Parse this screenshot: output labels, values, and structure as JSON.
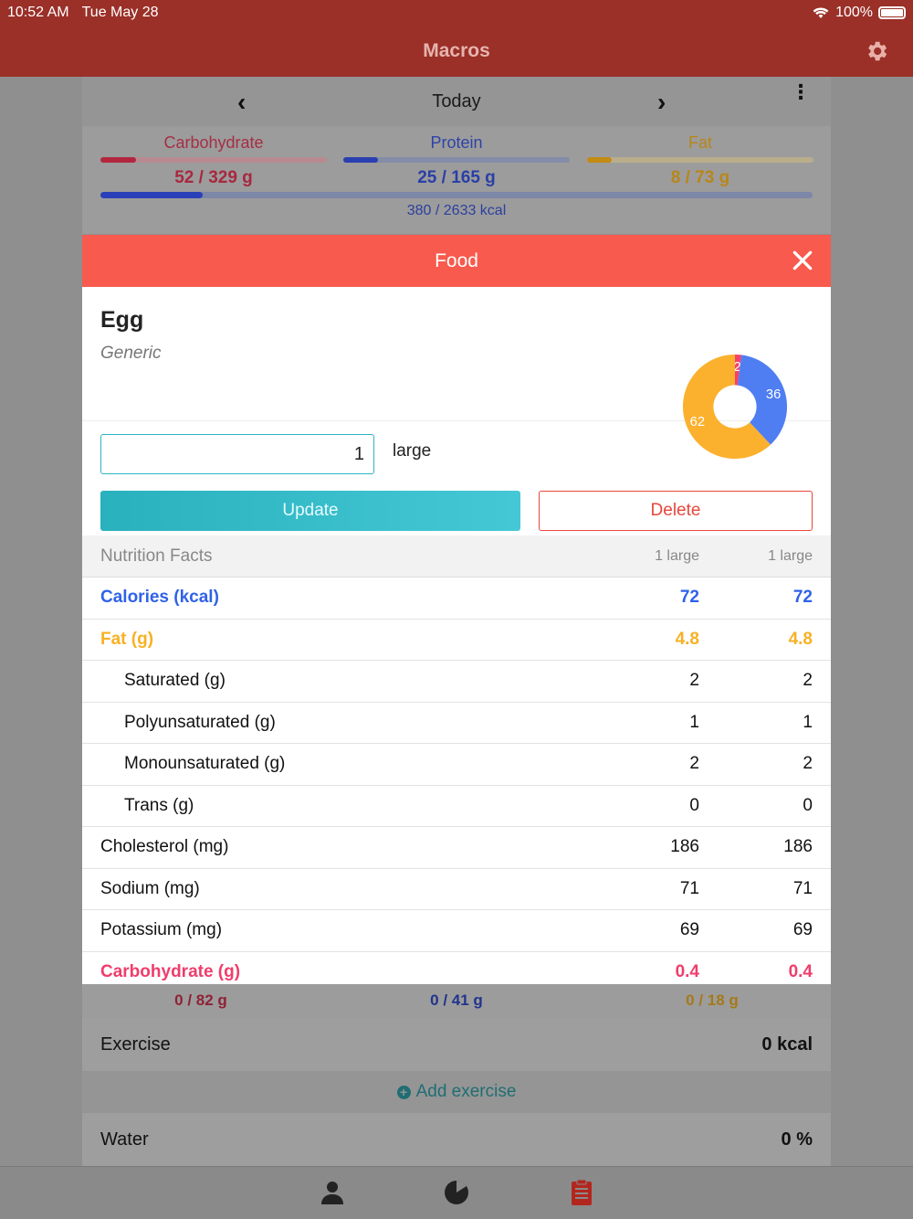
{
  "status": {
    "time": "10:52 AM",
    "date": "Tue May 28",
    "battery": "100%"
  },
  "app": {
    "title": "Macros"
  },
  "datebar": {
    "label": "Today"
  },
  "macros": {
    "carb": {
      "label": "Carbohydrate",
      "value": "52 / 329 g",
      "progress": 0.158
    },
    "protein": {
      "label": "Protein",
      "value": "25 / 165 g",
      "progress": 0.152
    },
    "fat": {
      "label": "Fat",
      "value": "8 / 73 g",
      "progress": 0.11
    },
    "kcal": {
      "value": "380 / 2633 kcal",
      "progress": 0.144
    }
  },
  "modal": {
    "title": "Food",
    "food_name": "Egg",
    "brand": "Generic",
    "quantity": "1",
    "unit": "large",
    "update_label": "Update",
    "delete_label": "Delete",
    "pie": {
      "segments": [
        {
          "label": "2",
          "value": 2,
          "color": "#f5426c"
        },
        {
          "label": "36",
          "value": 36,
          "color": "#4f7ef2"
        },
        {
          "label": "62",
          "value": 62,
          "color": "#fbb12e"
        }
      ]
    },
    "nutrition": {
      "header": {
        "title": "Nutrition Facts",
        "col1": "1 large",
        "col2": "1 large"
      },
      "rows": [
        {
          "name": "Calories (kcal)",
          "v1": "72",
          "v2": "72"
        },
        {
          "name": "Fat (g)",
          "v1": "4.8",
          "v2": "4.8"
        },
        {
          "name": "Saturated (g)",
          "v1": "2",
          "v2": "2"
        },
        {
          "name": "Polyunsaturated (g)",
          "v1": "1",
          "v2": "1"
        },
        {
          "name": "Monounsaturated (g)",
          "v1": "2",
          "v2": "2"
        },
        {
          "name": "Trans (g)",
          "v1": "0",
          "v2": "0"
        },
        {
          "name": "Cholesterol (mg)",
          "v1": "186",
          "v2": "186"
        },
        {
          "name": "Sodium (mg)",
          "v1": "71",
          "v2": "71"
        },
        {
          "name": "Potassium (mg)",
          "v1": "69",
          "v2": "69"
        },
        {
          "name": "Carbohydrate (g)",
          "v1": "0.4",
          "v2": "0.4"
        }
      ]
    }
  },
  "meal_summary": {
    "carb": "0 / 82 g",
    "protein": "0 / 41 g",
    "fat": "0 / 18 g"
  },
  "exercise": {
    "label": "Exercise",
    "value": "0 kcal",
    "add_label": "Add exercise"
  },
  "water": {
    "label": "Water",
    "value": "0 %"
  },
  "colors": {
    "header": "#9a3028",
    "modal_header": "#f85a4e",
    "update": "#2bb5c4",
    "delete": "#e9463c",
    "calories": "#2f62e8",
    "fat": "#f7b124",
    "carb": "#ef3d6c"
  },
  "icons": {
    "settings": "gear-icon",
    "close": "close-icon",
    "prev": "chevron-left-icon",
    "next": "chevron-right-icon",
    "more": "more-vertical-icon",
    "profile": "person-icon",
    "stats": "pie-chart-icon",
    "diary": "clipboard-icon"
  }
}
